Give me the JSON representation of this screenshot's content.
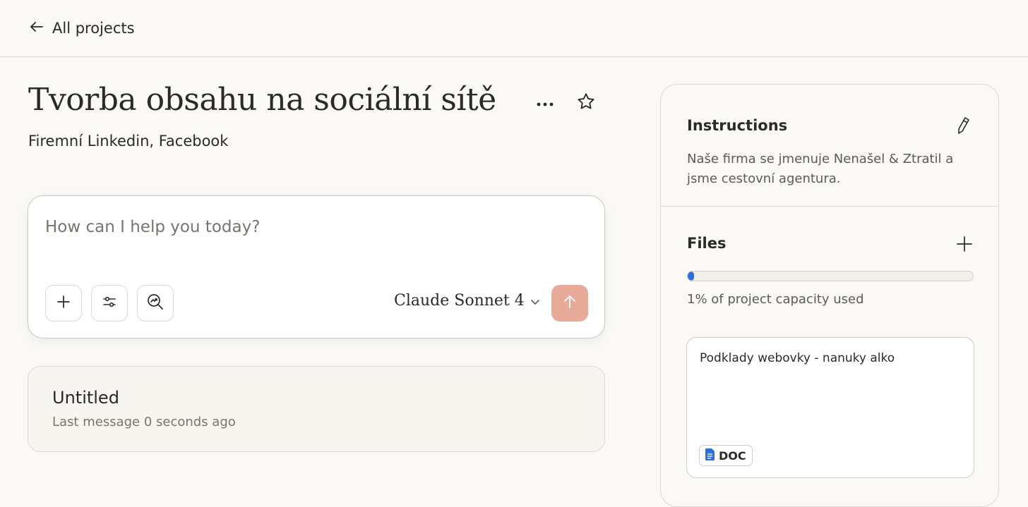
{
  "nav": {
    "back_label": "All projects"
  },
  "project": {
    "title": "Tvorba obsahu na sociální sítě",
    "subtitle": "Firemní Linkedin, Facebook"
  },
  "composer": {
    "placeholder": "How can I help you today?",
    "model": "Claude Sonnet 4"
  },
  "chats": [
    {
      "title": "Untitled",
      "meta": "Last message 0 seconds ago"
    }
  ],
  "panel": {
    "instructions_heading": "Instructions",
    "instructions_text": "Naše firma se jmenuje Nenašel & Ztratil a jsme cestovní agentura.",
    "files_heading": "Files",
    "capacity_percent": 1,
    "capacity_text": "1% of project capacity used",
    "files": [
      {
        "name": "Podklady webovky - nanuky alko",
        "type": "DOC"
      }
    ]
  },
  "colors": {
    "background": "#faf9f5",
    "send_button": "#e8aa99",
    "progress_fill": "#2f6fd9",
    "doc_icon": "#2f6fd9"
  },
  "icons": {
    "back": "arrow-left-icon",
    "more": "ellipsis-icon",
    "favorite": "star-icon",
    "attach": "plus-icon",
    "tools": "sliders-icon",
    "research": "search-trend-icon",
    "model_dropdown": "chevron-down-icon",
    "send": "arrow-up-icon",
    "edit": "pencil-icon",
    "add_file": "plus-icon",
    "doc": "document-icon"
  }
}
